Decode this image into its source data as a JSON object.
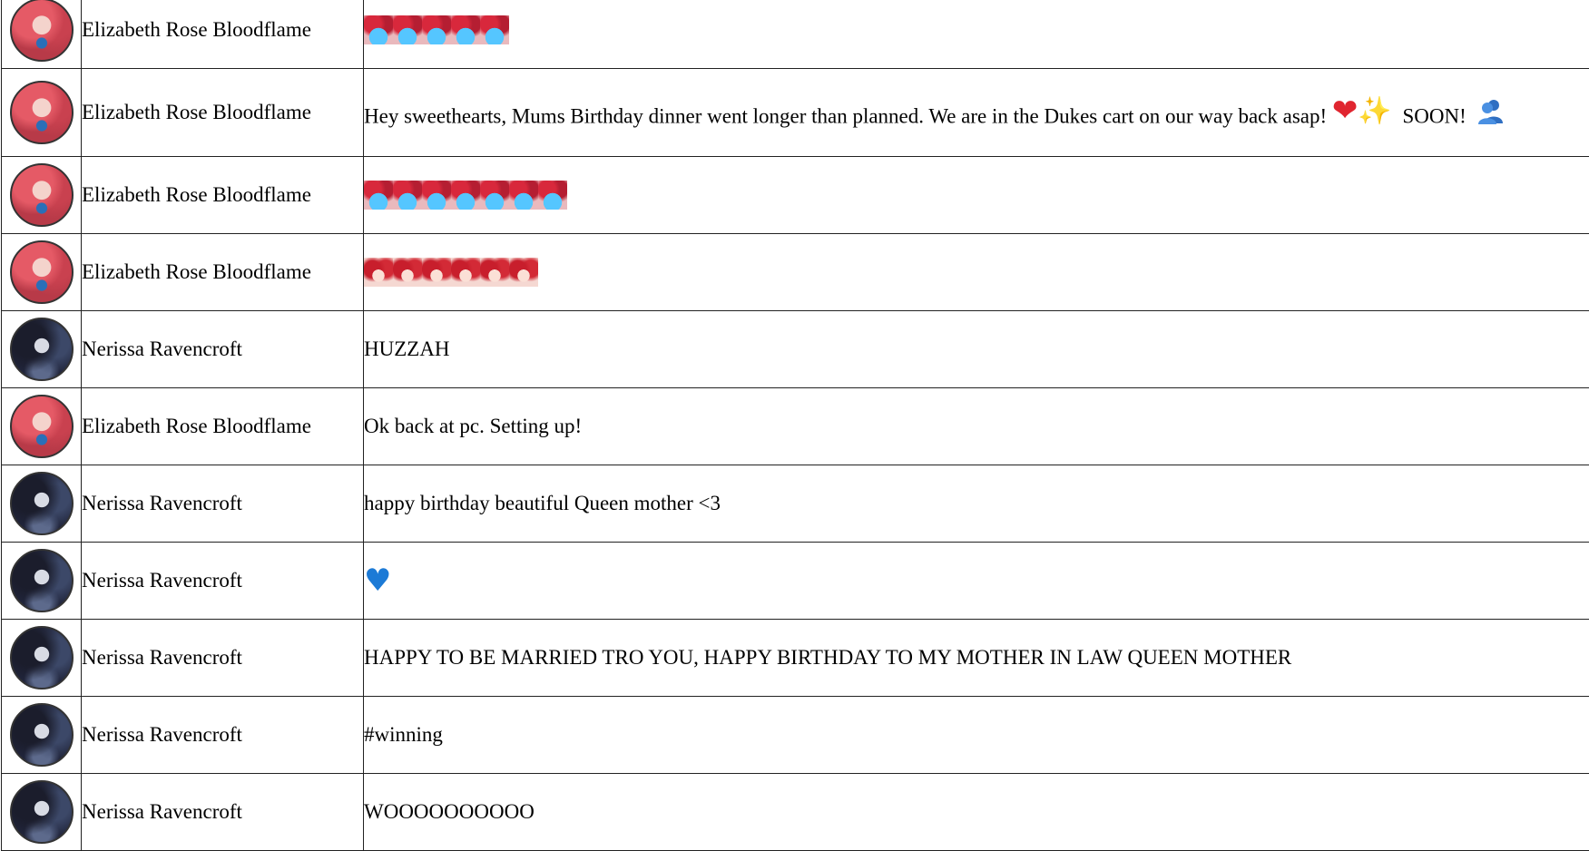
{
  "colors": {
    "border": "#222222",
    "red_heart": "#e0252f",
    "sparkles": "#f4c21a",
    "blue_heart": "#1c7ad6"
  },
  "messages": [
    {
      "avatar": "elizabeth-avatar",
      "name": "Elizabeth Rose Bloodflame",
      "emote": "blue-gem-emote",
      "emote_count": 5
    },
    {
      "avatar": "elizabeth-avatar",
      "name": "Elizabeth Rose Bloodflame",
      "text": "Hey sweethearts, Mums Birthday dinner went longer than planned. We are in the Dukes cart on our way back asap!",
      "text2": "SOON!",
      "icons": [
        "red-heart-icon",
        "sparkles-icon",
        "people-icon"
      ]
    },
    {
      "avatar": "elizabeth-avatar",
      "name": "Elizabeth Rose Bloodflame",
      "emote": "blue-gem-emote",
      "emote_count": 7
    },
    {
      "avatar": "elizabeth-avatar",
      "name": "Elizabeth Rose Bloodflame",
      "emote": "kiss-emote",
      "emote_count": 6
    },
    {
      "avatar": "nerissa-avatar",
      "name": "Nerissa Ravencroft",
      "text": "HUZZAH"
    },
    {
      "avatar": "elizabeth-avatar",
      "name": "Elizabeth Rose Bloodflame",
      "text": "Ok back at pc. Setting up!"
    },
    {
      "avatar": "nerissa-avatar",
      "name": "Nerissa Ravencroft",
      "text": "happy birthday beautiful Queen mother <3"
    },
    {
      "avatar": "nerissa-avatar",
      "name": "Nerissa Ravencroft",
      "icon": "blue-heart-icon"
    },
    {
      "avatar": "nerissa-avatar",
      "name": "Nerissa Ravencroft",
      "text": "HAPPY TO BE MARRIED TRO YOU, HAPPY BIRTHDAY TO MY MOTHER IN LAW QUEEN MOTHER"
    },
    {
      "avatar": "nerissa-avatar",
      "name": "Nerissa Ravencroft",
      "text": "#winning"
    },
    {
      "avatar": "nerissa-avatar",
      "name": "Nerissa Ravencroft",
      "text": "WOOOOOOOOOO"
    }
  ]
}
